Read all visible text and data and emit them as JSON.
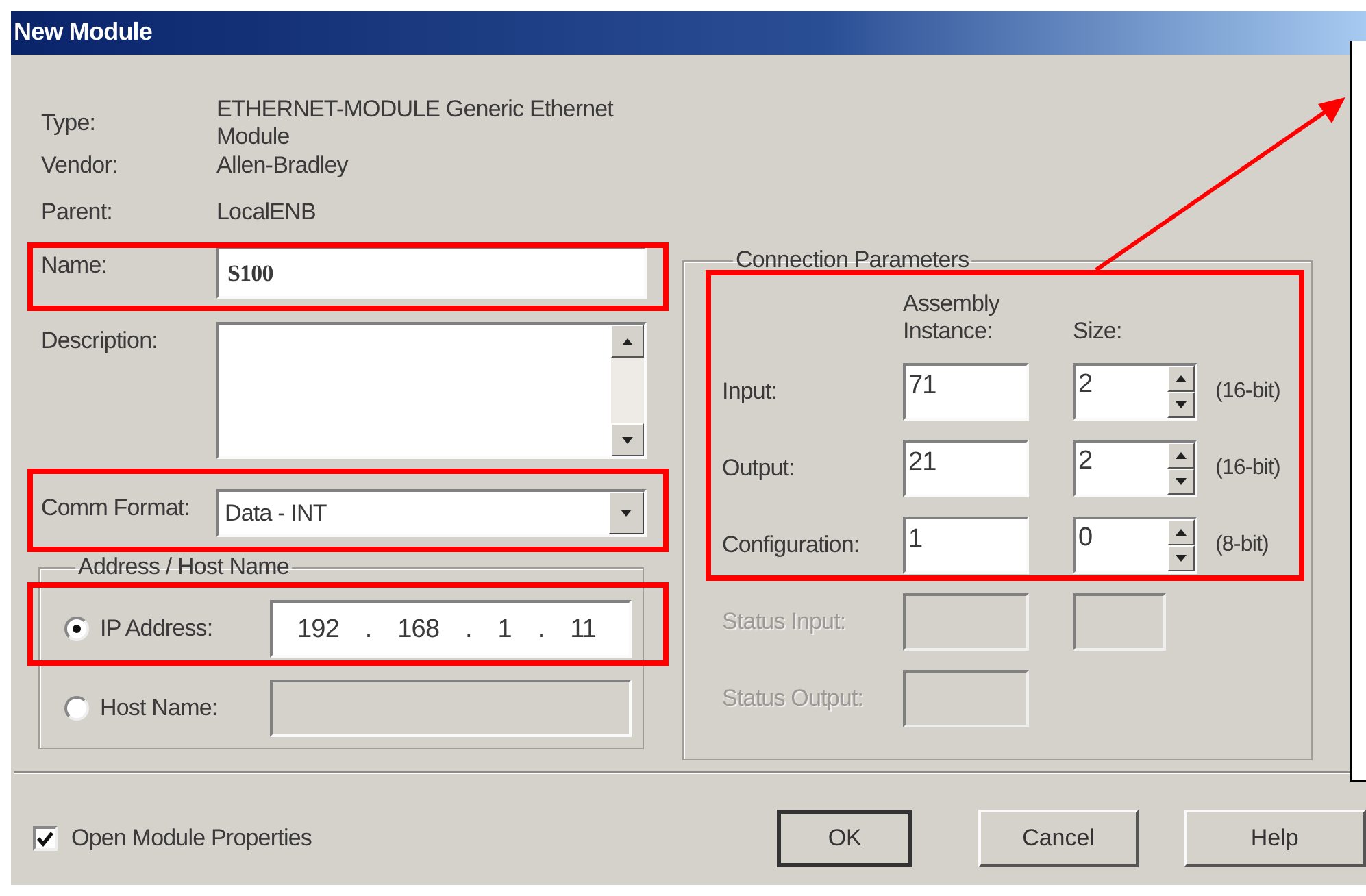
{
  "window": {
    "title": "New Module"
  },
  "info": [
    {
      "label": "Type:",
      "value": "ETHERNET-MODULE Generic Ethernet Module"
    },
    {
      "label": "Vendor:",
      "value": "Allen-Bradley"
    },
    {
      "label": "Parent:",
      "value": "LocalENB"
    }
  ],
  "name": {
    "label": "Name:",
    "value": "S100"
  },
  "description": {
    "label": "Description:"
  },
  "comm_format": {
    "label": "Comm Format:",
    "value": "Data - INT"
  },
  "address_group": {
    "title": "Address / Host Name",
    "options": [
      {
        "label": "IP Address:",
        "selected": true,
        "kind": "ip",
        "value": "192 . 168 . 1 . 11"
      },
      {
        "label": "Host Name:",
        "selected": false,
        "kind": "host"
      }
    ]
  },
  "connection": {
    "title": "Connection Parameters",
    "columns": [
      "Assembly Instance:",
      "Size:"
    ],
    "rows": [
      {
        "kind": "param",
        "label": "Input:",
        "instance": "71",
        "size": "2",
        "unit": "(16-bit)",
        "disabled": false
      },
      {
        "kind": "param",
        "label": "Output:",
        "instance": "21",
        "size": "2",
        "unit": "(16-bit)",
        "disabled": false
      },
      {
        "kind": "param",
        "label": "Configuration:",
        "instance": "1",
        "size": "0",
        "unit": "(8-bit)",
        "disabled": false
      },
      {
        "kind": "pair",
        "label": "Status Input:",
        "disabled": true
      },
      {
        "kind": "single",
        "label": "Status Output:",
        "disabled": true
      }
    ]
  },
  "open_properties": {
    "label": "Open Module Properties",
    "checked": true
  },
  "buttons": [
    {
      "label": "OK",
      "default": true
    },
    {
      "label": "Cancel",
      "default": false
    },
    {
      "label": "Help",
      "default": false
    }
  ],
  "annotations": [
    {
      "kind": "frame"
    },
    {
      "kind": "frame"
    },
    {
      "kind": "frame"
    },
    {
      "kind": "frame"
    },
    {
      "kind": "arrow"
    },
    {
      "kind": "callout"
    }
  ]
}
